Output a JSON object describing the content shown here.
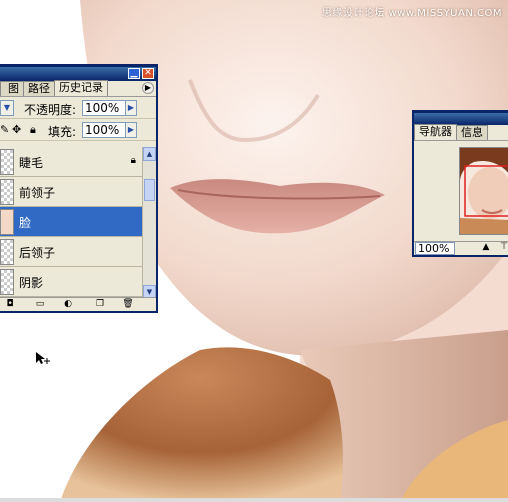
{
  "watermark": "思缘设计论坛 www.MISSYUAN.COM",
  "layers_panel": {
    "tabs": [
      {
        "label": "图层"
      },
      {
        "label": "路径"
      },
      {
        "label": "历史记录"
      }
    ],
    "opacity_label": "不透明度:",
    "opacity_value": "100%",
    "fill_label": "填充:",
    "fill_value": "100%",
    "layers": [
      {
        "name": "睫毛",
        "locked": true,
        "selected": false
      },
      {
        "name": "前领子",
        "locked": false,
        "selected": false
      },
      {
        "name": "脸",
        "locked": false,
        "selected": true
      },
      {
        "name": "后领子",
        "locked": false,
        "selected": false
      },
      {
        "name": "阴影",
        "locked": false,
        "selected": false
      }
    ]
  },
  "navigator_panel": {
    "tabs": [
      {
        "label": "导航器"
      },
      {
        "label": "信息"
      }
    ],
    "zoom_value": "100%",
    "view_box_color": "#e02020"
  },
  "colors": {
    "title_bar": "#0a246a",
    "selection": "#316ac5",
    "panel_bg": "#ece9d8"
  }
}
